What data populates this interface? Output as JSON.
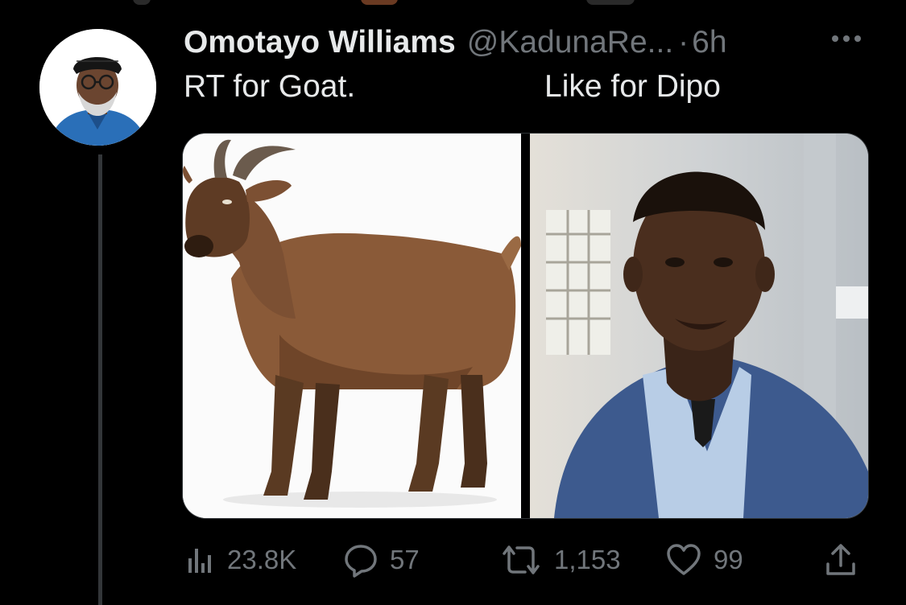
{
  "tweet": {
    "author_name": "Omotayo Williams",
    "handle": "@KadunaRe...",
    "separator": "·",
    "time": "6h",
    "text_left": "RT for Goat.",
    "text_right": "Like for Dipo"
  },
  "media": {
    "left_alt": "goat",
    "right_alt": "man in blue suit"
  },
  "actions": {
    "views": "23.8K",
    "replies": "57",
    "retweets": "1,153",
    "likes": "99"
  },
  "colors": {
    "background": "#000000",
    "text": "#e7e9ea",
    "muted": "#71767b",
    "thread_line": "#333639"
  },
  "icons": [
    "more-icon",
    "views-icon",
    "reply-icon",
    "retweet-icon",
    "like-icon",
    "share-icon"
  ]
}
